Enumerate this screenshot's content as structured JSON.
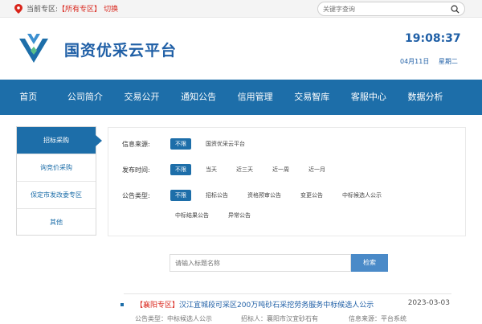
{
  "topbar": {
    "location_label": "当前专区:",
    "zone_label": "【所有专区】",
    "switch_label": "切换",
    "search_placeholder": "关键字查询"
  },
  "header": {
    "brand": "国资优采云平台",
    "time": "19:08:37",
    "date": "04月11日",
    "weekday": "星期二"
  },
  "nav": {
    "items": [
      "首页",
      "公司简介",
      "交易公开",
      "通知公告",
      "信用管理",
      "交易智库",
      "客服中心",
      "数据分析"
    ]
  },
  "sidebar": {
    "items": [
      "招标采购",
      "询竞价采购",
      "保定市发改委专区",
      "其他"
    ],
    "active": "招标采购"
  },
  "filters": {
    "source": {
      "label": "信息来源:",
      "options": [
        "不限",
        "国资优采云平台"
      ]
    },
    "time": {
      "label": "发布时间:",
      "options": [
        "不限",
        "当天",
        "近三天",
        "近一周",
        "近一月"
      ]
    },
    "type": {
      "label": "公告类型:",
      "options": [
        "不限",
        "招标公告",
        "资格预审公告",
        "变更公告",
        "中标候选人公示",
        "中标结果公告",
        "异常公告"
      ]
    }
  },
  "search": {
    "placeholder": "请输入标题名称",
    "button": "检索"
  },
  "results": [
    {
      "zone": "【襄阳专区】",
      "title": "汉江宜城段可采区200万吨砂石采挖劳务服务中标候选人公示",
      "date": "2023-03-03",
      "meta_type": "公告类型：中标候选人公示",
      "meta_agent": "招标人：襄阳市汉宜砂石有",
      "meta_source": "信息来源：平台系统"
    }
  ],
  "colors": {
    "brand_blue": "#1d6ea9",
    "accent_red": "#d9251b",
    "search_button": "#4a8ac8"
  }
}
